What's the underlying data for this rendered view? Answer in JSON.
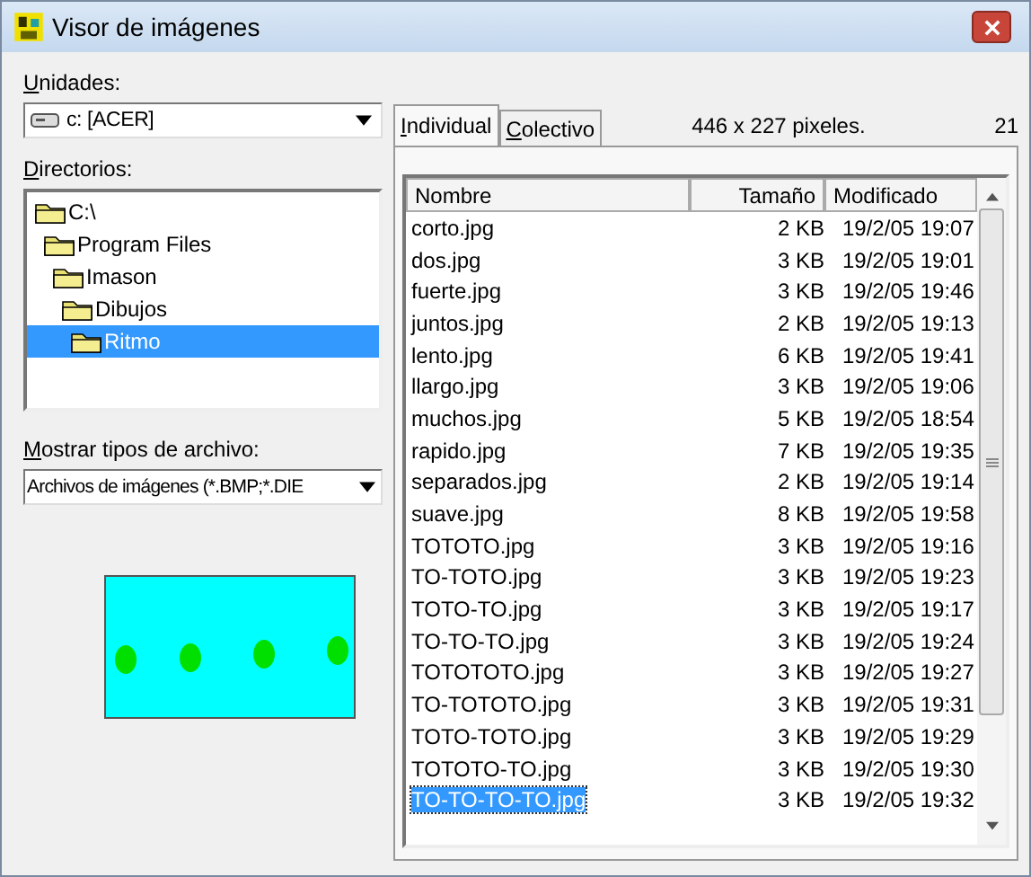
{
  "window": {
    "title": "Visor de imágenes"
  },
  "drives": {
    "label": "Unidades:",
    "value": "c: [ACER]"
  },
  "directories": {
    "label": "Directorios:",
    "tree": [
      {
        "name": "C:\\",
        "selected": false,
        "children": [
          {
            "name": "Program Files",
            "selected": false,
            "children": [
              {
                "name": "Imason",
                "selected": false,
                "children": [
                  {
                    "name": "Dibujos",
                    "selected": false,
                    "children": [
                      {
                        "name": "Ritmo",
                        "selected": true
                      }
                    ]
                  }
                ]
              }
            ]
          }
        ]
      }
    ]
  },
  "file_types": {
    "label": "Mostrar tipos de archivo:",
    "value": "Archivos de imágenes (*.BMP;*.DIE"
  },
  "tabs": [
    {
      "label": "Individual",
      "selected": true
    },
    {
      "label": "Colectivo",
      "selected": false
    }
  ],
  "image_info": "446 x 227 pixeles.",
  "file_count": "21",
  "table": {
    "columns": [
      "Nombre",
      "Tamaño",
      "Modificado"
    ],
    "rows": [
      {
        "name": "corto.jpg",
        "size": "2 KB",
        "modified": "19/2/05 19:07",
        "selected": false
      },
      {
        "name": "dos.jpg",
        "size": "3 KB",
        "modified": "19/2/05 19:01",
        "selected": false
      },
      {
        "name": "fuerte.jpg",
        "size": "3 KB",
        "modified": "19/2/05 19:46",
        "selected": false
      },
      {
        "name": "juntos.jpg",
        "size": "2 KB",
        "modified": "19/2/05 19:13",
        "selected": false
      },
      {
        "name": "lento.jpg",
        "size": "6 KB",
        "modified": "19/2/05 19:41",
        "selected": false
      },
      {
        "name": "llargo.jpg",
        "size": "3 KB",
        "modified": "19/2/05 19:06",
        "selected": false
      },
      {
        "name": "muchos.jpg",
        "size": "5 KB",
        "modified": "19/2/05 18:54",
        "selected": false
      },
      {
        "name": "rapido.jpg",
        "size": "7 KB",
        "modified": "19/2/05 19:35",
        "selected": false
      },
      {
        "name": "separados.jpg",
        "size": "2 KB",
        "modified": "19/2/05 19:14",
        "selected": false
      },
      {
        "name": "suave.jpg",
        "size": "8 KB",
        "modified": "19/2/05 19:58",
        "selected": false
      },
      {
        "name": "TOTOTO.jpg",
        "size": "3 KB",
        "modified": "19/2/05 19:16",
        "selected": false
      },
      {
        "name": "TO-TOTO.jpg",
        "size": "3 KB",
        "modified": "19/2/05 19:23",
        "selected": false
      },
      {
        "name": "TOTO-TO.jpg",
        "size": "3 KB",
        "modified": "19/2/05 19:17",
        "selected": false
      },
      {
        "name": "TO-TO-TO.jpg",
        "size": "3 KB",
        "modified": "19/2/05 19:24",
        "selected": false
      },
      {
        "name": "TOTOTOTO.jpg",
        "size": "3 KB",
        "modified": "19/2/05 19:27",
        "selected": false
      },
      {
        "name": "TO-TOTOTO.jpg",
        "size": "3 KB",
        "modified": "19/2/05 19:31",
        "selected": false
      },
      {
        "name": "TOTO-TOTO.jpg",
        "size": "3 KB",
        "modified": "19/2/05 19:29",
        "selected": false
      },
      {
        "name": "TOTOTO-TO.jpg",
        "size": "3 KB",
        "modified": "19/2/05 19:30",
        "selected": false
      },
      {
        "name": "TO-TO-TO-TO.jpg",
        "size": "3 KB",
        "modified": "19/2/05 19:32",
        "selected": true
      }
    ]
  }
}
